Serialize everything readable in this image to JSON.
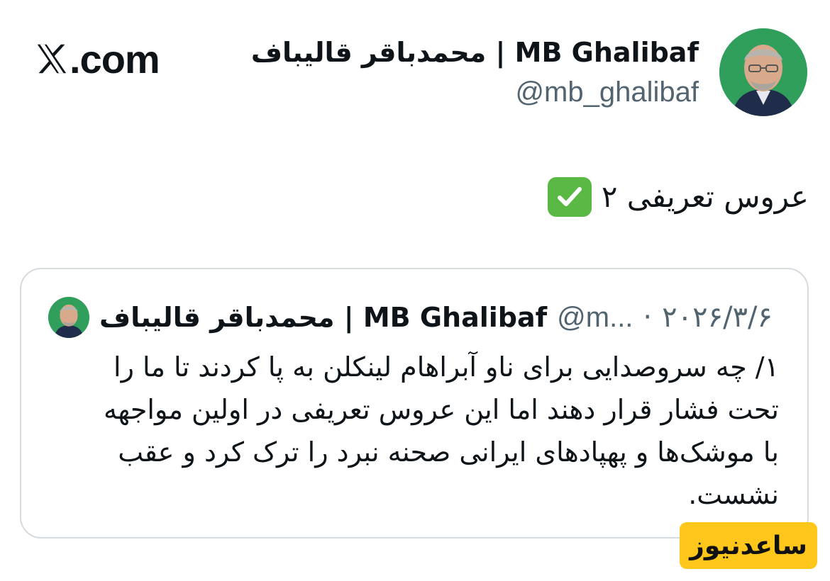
{
  "brand": {
    "logo_text": ".com"
  },
  "author": {
    "display_name": "محمدباقر قالیباف | MB Ghalibaf",
    "handle": "@mb_ghalibaf"
  },
  "tweet": {
    "text": "عروس تعریفی ۲",
    "emoji": "check-mark-button"
  },
  "quoted_tweet": {
    "display_name": "محمدباقر قالیباف | MB Ghalibaf",
    "handle": "@m...",
    "separator": "·",
    "date": "۲۰۲۶/۳/۶",
    "lines": [
      "۱/ چه سروصدایی برای ناو آبراهام لینکلن به پا کردند تا ما را",
      "تحت فشار قرار دهند اما این عروس تعریفی در اولین مواجهه",
      "با موشک‌ها و پهپادهای ایرانی صحنه نبرد را ترک کرد و عقب",
      "نشست."
    ]
  },
  "watermark": {
    "text": "ساعدنیوز"
  },
  "colors": {
    "text_primary": "#0f1419",
    "text_secondary": "#536471",
    "card_border": "#d6dbdf",
    "avatar_bg": "#2f9f5b",
    "check_green": "#5ab945",
    "watermark_bg": "#ffc61b"
  }
}
